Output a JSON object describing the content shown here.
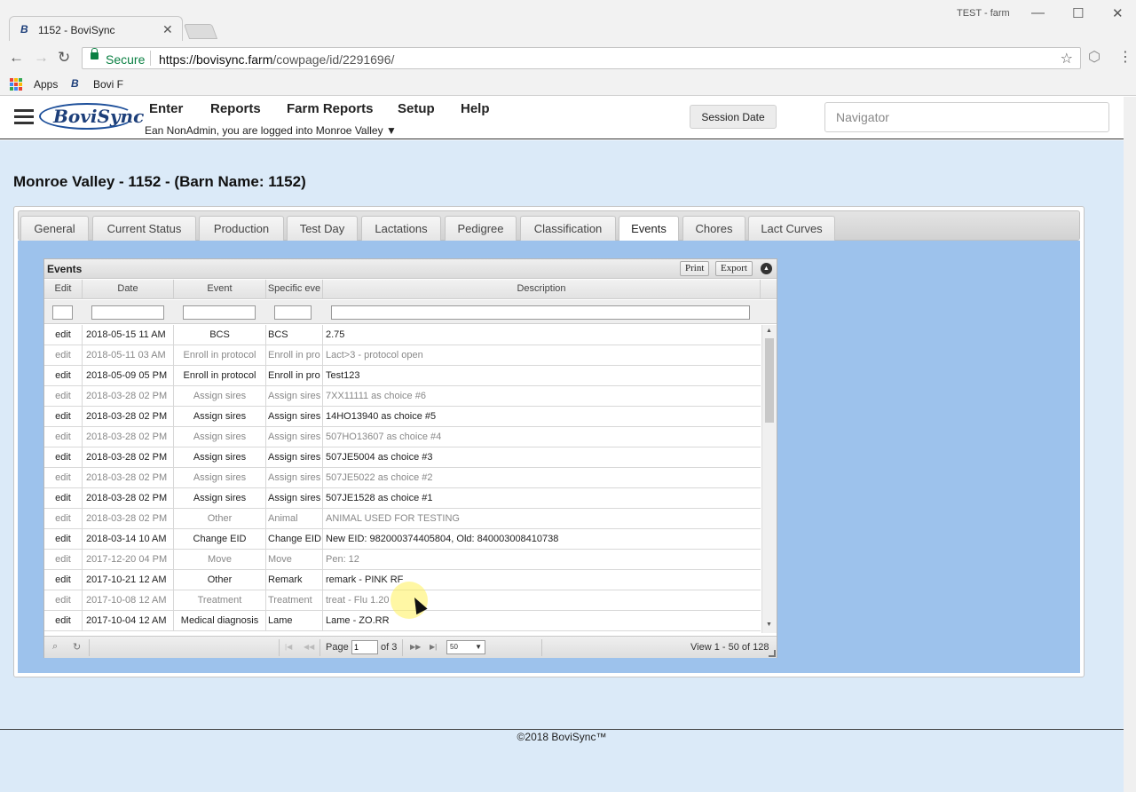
{
  "browser": {
    "tab_title": "1152 - BoviSync",
    "tab_favicon": "B",
    "profile_label": "TEST - farm",
    "secure_label": "Secure",
    "url_host": "https://bovisync.farm",
    "url_path": "/cowpage/id/2291696/",
    "bookmarks": [
      {
        "label": "Apps",
        "icon": "apps-grid-icon"
      },
      {
        "label": "Bovi F",
        "icon": "bovisync-favicon"
      }
    ],
    "bookmark_favicon": "B"
  },
  "app": {
    "logo_text": "BoviSync",
    "menu": [
      "Enter",
      "Reports",
      "Farm Reports",
      "Setup",
      "Help"
    ],
    "login_info": "Ean NonAdmin, you are logged into Monroe Valley ▼",
    "session_button": "Session Date",
    "navigator_placeholder": "Navigator"
  },
  "page": {
    "title": "Monroe Valley - 1152 - (Barn Name: 1152)",
    "tabs": [
      "General",
      "Current Status",
      "Production",
      "Test Day",
      "Lactations",
      "Pedigree",
      "Classification",
      "Events",
      "Chores",
      "Lact Curves"
    ],
    "active_tab": "Events"
  },
  "grid": {
    "caption": "Events",
    "print_label": "Print",
    "export_label": "Export",
    "columns": [
      "Edit",
      "Date",
      "Event",
      "Specific eve",
      "Description"
    ],
    "rows": [
      {
        "edit": "edit",
        "date": "2018-05-15 11 AM",
        "event": "BCS",
        "specific": "BCS",
        "description": "2.75",
        "dim": false
      },
      {
        "edit": "edit",
        "date": "2018-05-11 03 AM",
        "event": "Enroll in protocol",
        "specific": "Enroll in pro",
        "description": "Lact>3 - protocol open",
        "dim": true
      },
      {
        "edit": "edit",
        "date": "2018-05-09 05 PM",
        "event": "Enroll in protocol",
        "specific": "Enroll in pro",
        "description": "Test123",
        "dim": false
      },
      {
        "edit": "edit",
        "date": "2018-03-28 02 PM",
        "event": "Assign sires",
        "specific": "Assign sires",
        "description": "7XX11111 as choice #6",
        "dim": true
      },
      {
        "edit": "edit",
        "date": "2018-03-28 02 PM",
        "event": "Assign sires",
        "specific": "Assign sires",
        "description": "14HO13940 as choice #5",
        "dim": false
      },
      {
        "edit": "edit",
        "date": "2018-03-28 02 PM",
        "event": "Assign sires",
        "specific": "Assign sires",
        "description": "507HO13607 as choice #4",
        "dim": true
      },
      {
        "edit": "edit",
        "date": "2018-03-28 02 PM",
        "event": "Assign sires",
        "specific": "Assign sires",
        "description": "507JE5004 as choice #3",
        "dim": false
      },
      {
        "edit": "edit",
        "date": "2018-03-28 02 PM",
        "event": "Assign sires",
        "specific": "Assign sires",
        "description": "507JE5022 as choice #2",
        "dim": true
      },
      {
        "edit": "edit",
        "date": "2018-03-28 02 PM",
        "event": "Assign sires",
        "specific": "Assign sires",
        "description": "507JE1528 as choice #1",
        "dim": false
      },
      {
        "edit": "edit",
        "date": "2018-03-28 02 PM",
        "event": "Other",
        "specific": "Animal",
        "description": "ANIMAL USED FOR TESTING",
        "dim": true
      },
      {
        "edit": "edit",
        "date": "2018-03-14 10 AM",
        "event": "Change EID",
        "specific": "Change EID",
        "description": "New EID: 982000374405804, Old: 840003008410738",
        "dim": false
      },
      {
        "edit": "edit",
        "date": "2017-12-20 04 PM",
        "event": "Move",
        "specific": "Move",
        "description": "Pen: 12",
        "dim": true
      },
      {
        "edit": "edit",
        "date": "2017-10-21 12 AM",
        "event": "Other",
        "specific": "Remark",
        "description": "remark - PINK RF",
        "dim": false
      },
      {
        "edit": "edit",
        "date": "2017-10-08 12 AM",
        "event": "Treatment",
        "specific": "Treatment",
        "description": "treat - Flu 1.20",
        "dim": true
      },
      {
        "edit": "edit",
        "date": "2017-10-04 12 AM",
        "event": "Medical diagnosis",
        "specific": "Lame",
        "description": "Lame - ZO.RR",
        "dim": false
      }
    ],
    "pager": {
      "page_label": "Page",
      "page_value": "1",
      "of_label": "of 3",
      "rows_per_page": "50",
      "view_label": "View 1 - 50 of 128"
    }
  },
  "footer": {
    "copyright": "©2018 BoviSync™"
  },
  "colors": {
    "page_bg": "#dbeaf8",
    "tab_content_bg": "#9dc2ec",
    "brand": "#1d3f7a",
    "secure_green": "#0b8043"
  }
}
